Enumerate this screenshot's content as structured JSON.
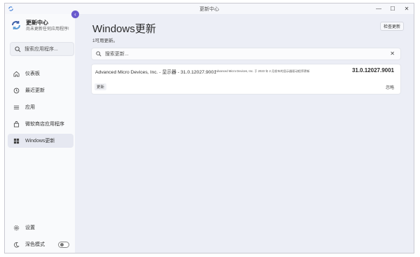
{
  "window": {
    "title": "更新中心",
    "controls": [
      "—",
      "☐",
      "✕"
    ]
  },
  "brand": {
    "title": "更新中心",
    "subtitle": "尚未更新任何应用程序!"
  },
  "sidebar": {
    "search_placeholder": "搜索应用程序...",
    "items": [
      {
        "label": "仪表板",
        "icon": "home-icon",
        "active": false
      },
      {
        "label": "最近更新",
        "icon": "history-icon",
        "active": false
      },
      {
        "label": "应用",
        "icon": "list-icon",
        "active": false
      },
      {
        "label": "微软商店应用程序",
        "icon": "store-icon",
        "active": false
      },
      {
        "label": "Windows更新",
        "icon": "windows-icon",
        "active": true
      }
    ],
    "settings_label": "设置",
    "dark_mode_label": "深色模式",
    "dark_mode_on": false
  },
  "main": {
    "title": "Windows更新",
    "check_button": "检查更新",
    "count_text": "1可用更新。",
    "search_placeholder": "搜索更新...",
    "updates": [
      {
        "name": "Advanced Micro Devices, Inc. - 显示器 - 31.0.12027.9001",
        "description": "Advanced Micro Devices, Inc. 于 2023 年 2 月发布的显示器驱动程序更新",
        "version": "31.0.12027.9001",
        "tag": "更新",
        "ignore_label": "忽略"
      }
    ]
  },
  "colors": {
    "accent": "#6a5acd",
    "sidebar_bg": "#f9fafc",
    "main_bg": "#eceef6"
  }
}
